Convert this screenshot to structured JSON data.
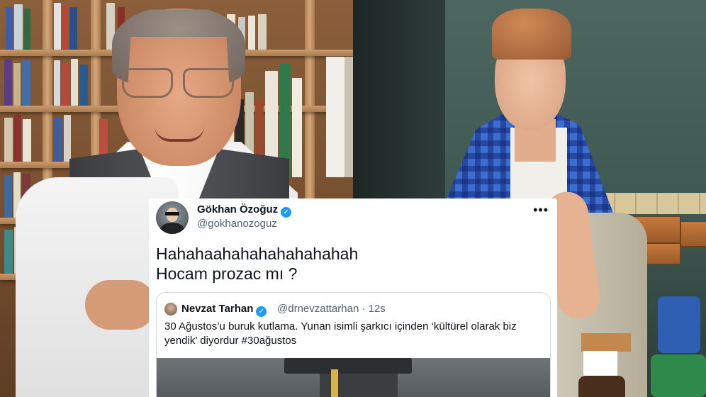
{
  "tweet": {
    "author": {
      "name": "Gökhan Özoğuz",
      "handle": "@gokhanozoguz",
      "verified_mark": "✓"
    },
    "more_icon": "•••",
    "text_lines": [
      "Hahahaahahahahahahahah",
      "Hocam prozac mı ?"
    ],
    "quote": {
      "name": "Nevzat Tarhan",
      "verified_mark": "✓",
      "handle_time": "@drnevzattarhan · 12s",
      "text": "30 Ağustos’u buruk kutlama. Yunan isimli şarkıcı içinden ‘kültürel olarak biz yendik’ diyordur #30ağustos"
    }
  },
  "colors": {
    "verified": "#1d9bf0",
    "text_primary": "#0f1419",
    "text_secondary": "#536471",
    "card_border": "#cfd9de"
  },
  "icons": [
    "verified-badge-icon",
    "more-options-icon"
  ]
}
